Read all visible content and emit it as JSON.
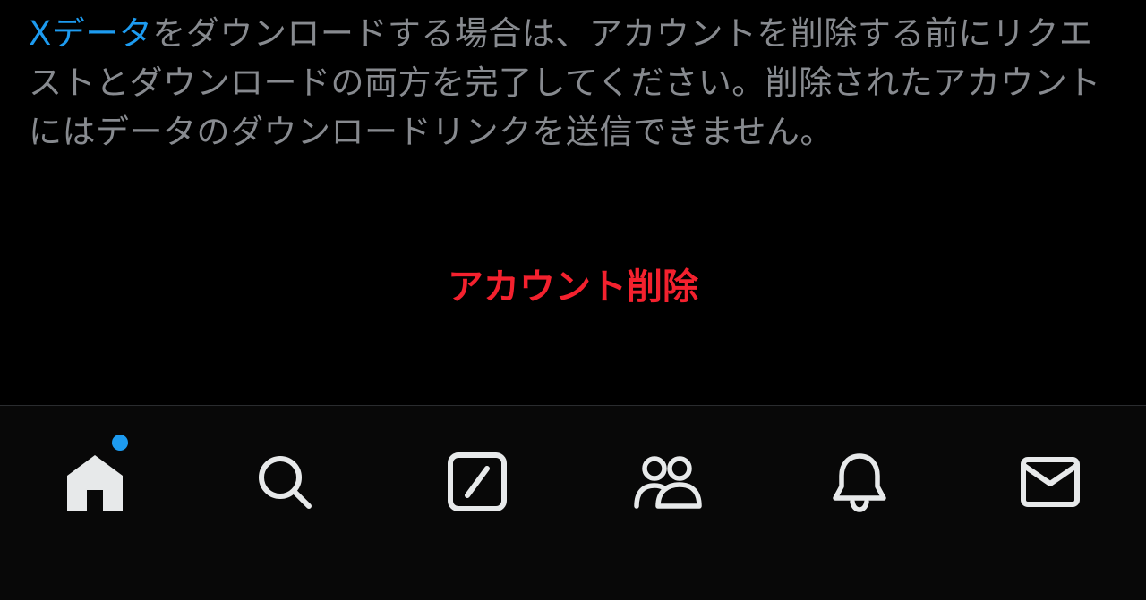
{
  "info": {
    "link_text": "Xデータ",
    "body_text": "をダウンロードする場合は、アカウントを削除する前にリクエストとダウンロードの両方を完了してください。削除されたアカウントにはデータのダウンロードリンクを送信できません。"
  },
  "actions": {
    "delete_account_label": "アカウント削除"
  },
  "tabbar": {
    "tabs": [
      {
        "icon": "home-icon",
        "has_badge": true
      },
      {
        "icon": "search-icon"
      },
      {
        "icon": "grok-icon"
      },
      {
        "icon": "communities-icon"
      },
      {
        "icon": "bell-icon"
      },
      {
        "icon": "mail-icon"
      }
    ]
  },
  "colors": {
    "background": "#000000",
    "tabbar_background": "#080808",
    "body_text": "#878a8f",
    "link": "#1d9bf0",
    "danger": "#f4212e",
    "icon": "#e7e9ea",
    "badge": "#1d9bf0"
  }
}
